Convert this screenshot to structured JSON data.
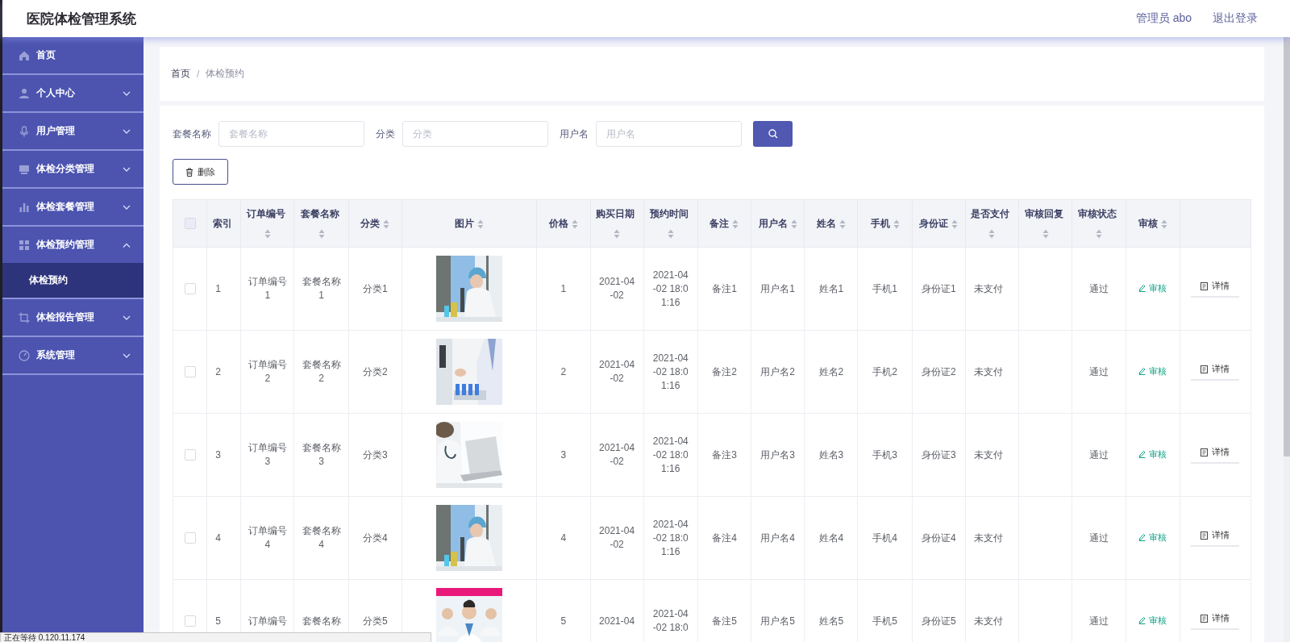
{
  "header": {
    "title": "医院体检管理系统",
    "user": "管理员 abo",
    "logout": "退出登录"
  },
  "sidebar": {
    "items": [
      {
        "label": "首页",
        "kind": "link",
        "selected": false
      },
      {
        "label": "个人中心",
        "kind": "submenu",
        "expanded": false,
        "selected": false
      },
      {
        "label": "用户管理",
        "kind": "submenu",
        "expanded": false,
        "selected": false
      },
      {
        "label": "体检分类管理",
        "kind": "submenu",
        "expanded": false,
        "selected": false
      },
      {
        "label": "体检套餐管理",
        "kind": "submenu",
        "expanded": false,
        "selected": false
      },
      {
        "label": "体检预约管理",
        "kind": "submenu",
        "expanded": true,
        "selected": false,
        "children": [
          {
            "label": "体检预约",
            "selected": true
          }
        ]
      },
      {
        "label": "体检报告管理",
        "kind": "submenu",
        "expanded": false,
        "selected": false
      },
      {
        "label": "系统管理",
        "kind": "submenu",
        "expanded": false,
        "selected": false
      }
    ]
  },
  "breadcrumb": {
    "items": [
      "首页",
      "体检预约"
    ],
    "separator": "/"
  },
  "search": {
    "fields": [
      {
        "label": "套餐名称",
        "placeholder": "套餐名称"
      },
      {
        "label": "分类",
        "placeholder": "分类"
      },
      {
        "label": "用户名",
        "placeholder": "用户名"
      }
    ]
  },
  "toolbar": {
    "delete": "删除"
  },
  "table": {
    "all_checked": false,
    "columns": [
      {
        "label": "索引",
        "sortable": false
      },
      {
        "label": "订单编号",
        "sortable": true
      },
      {
        "label": "套餐名称",
        "sortable": true
      },
      {
        "label": "分类",
        "sortable": true
      },
      {
        "label": "图片",
        "sortable": true
      },
      {
        "label": "价格",
        "sortable": true
      },
      {
        "label": "购买日期",
        "sortable": true
      },
      {
        "label": "预约时间",
        "sortable": true
      },
      {
        "label": "备注",
        "sortable": true
      },
      {
        "label": "用户名",
        "sortable": true
      },
      {
        "label": "姓名",
        "sortable": true
      },
      {
        "label": "手机",
        "sortable": true
      },
      {
        "label": "身份证",
        "sortable": true
      },
      {
        "label": "是否支付",
        "sortable": true
      },
      {
        "label": "审核回复",
        "sortable": true
      },
      {
        "label": "审核状态",
        "sortable": true
      },
      {
        "label": "审核",
        "sortable": true
      }
    ],
    "rows": [
      {
        "checked": false,
        "index": "1",
        "order_no": "订单编号1",
        "package_name": "套餐名称1",
        "category": "分类1",
        "price": "1",
        "purchase_date": "2021-04-02",
        "appointment_time": "2021-04-02 18:01:16",
        "remark": "备注1",
        "username": "用户名1",
        "name": "姓名1",
        "phone": "手机1",
        "id_card": "身份证1",
        "paid": "未支付",
        "review_status": "通过",
        "review": "审核",
        "detail": "详情"
      },
      {
        "checked": false,
        "index": "2",
        "order_no": "订单编号2",
        "package_name": "套餐名称2",
        "category": "分类2",
        "price": "2",
        "purchase_date": "2021-04-02",
        "appointment_time": "2021-04-02 18:01:16",
        "remark": "备注2",
        "username": "用户名2",
        "name": "姓名2",
        "phone": "手机2",
        "id_card": "身份证2",
        "paid": "未支付",
        "review_status": "通过",
        "review": "审核",
        "detail": "详情"
      },
      {
        "checked": false,
        "index": "3",
        "order_no": "订单编号3",
        "package_name": "套餐名称3",
        "category": "分类3",
        "price": "3",
        "purchase_date": "2021-04-02",
        "appointment_time": "2021-04-02 18:01:16",
        "remark": "备注3",
        "username": "用户名3",
        "name": "姓名3",
        "phone": "手机3",
        "id_card": "身份证3",
        "paid": "未支付",
        "review_status": "通过",
        "review": "审核",
        "detail": "详情"
      },
      {
        "checked": false,
        "index": "4",
        "order_no": "订单编号4",
        "package_name": "套餐名称4",
        "category": "分类4",
        "price": "4",
        "purchase_date": "2021-04-02",
        "appointment_time": "2021-04-02 18:01:16",
        "remark": "备注4",
        "username": "用户名4",
        "name": "姓名4",
        "phone": "手机4",
        "id_card": "身份证4",
        "paid": "未支付",
        "review_status": "通过",
        "review": "审核",
        "detail": "详情"
      },
      {
        "checked": false,
        "index": "5",
        "order_no": "订单编号",
        "package_name": "套餐名称",
        "category": "分类5",
        "price": "5",
        "purchase_date": "2021-04",
        "appointment_time": "2021-04-02 18:0",
        "remark": "备注5",
        "username": "用户名5",
        "name": "姓名5",
        "phone": "手机5",
        "id_card": "身份证5",
        "paid": "未支付",
        "review_status": "通过",
        "review": "审核",
        "detail": "详情"
      }
    ]
  },
  "status_bar": "正在等待 0.120.11.174"
}
